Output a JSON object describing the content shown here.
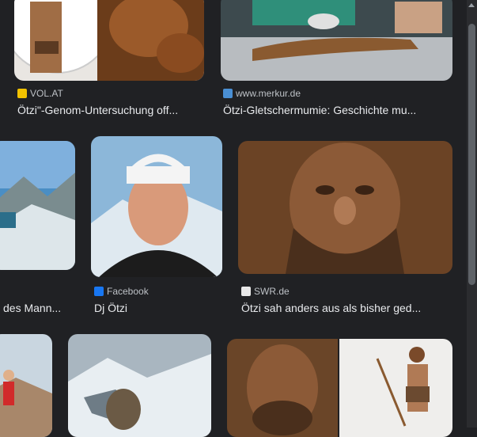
{
  "row1": [
    {
      "source": "VOL.AT",
      "title": "Ötzi\"-Genom-Untersuchung off...",
      "favicon_color": "#f2c200"
    },
    {
      "source": "www.merkur.de",
      "title": "Ötzi-Gletschermumie: Geschichte mu...",
      "favicon_color": "#4a8fd4"
    }
  ],
  "row2": [
    {
      "source": "",
      "title": "des Mann..."
    },
    {
      "source": "Facebook",
      "title": "Dj Ötzi",
      "favicon_color": "#1877f2"
    },
    {
      "source": "SWR.de",
      "title": "Ötzi sah anders aus als bisher ged...",
      "favicon_color": "#e8e8e8"
    }
  ],
  "colors": {
    "background": "#202124",
    "text": "#e8eaed",
    "source_text": "#bdc1c6"
  }
}
